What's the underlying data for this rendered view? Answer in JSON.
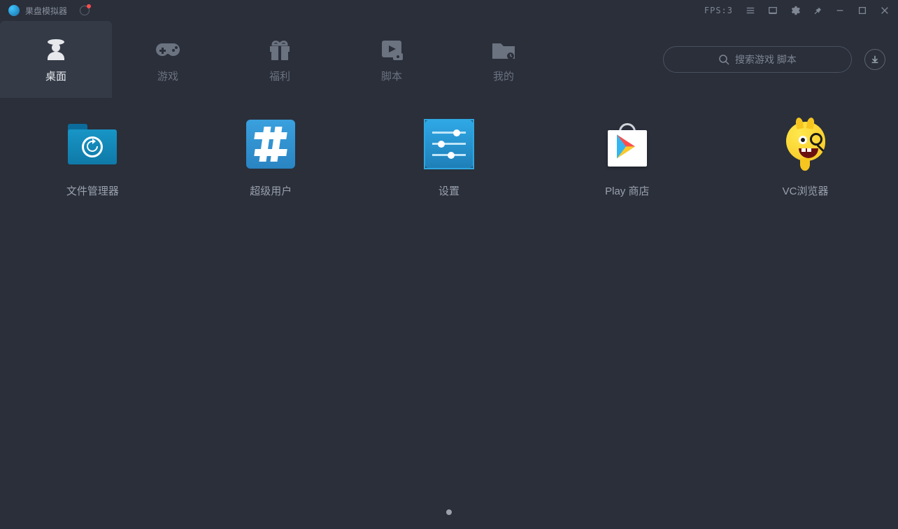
{
  "titlebar": {
    "app_name": "果盘模拟器",
    "fps_label": "FPS:3"
  },
  "tabs": [
    {
      "label": "桌面",
      "icon": "desktop-user-icon",
      "active": true
    },
    {
      "label": "游戏",
      "icon": "gamepad-icon",
      "active": false
    },
    {
      "label": "福利",
      "icon": "gift-icon",
      "active": false
    },
    {
      "label": "脚本",
      "icon": "script-icon",
      "active": false
    },
    {
      "label": "我的",
      "icon": "my-folder-icon",
      "active": false
    }
  ],
  "search": {
    "placeholder": "搜索游戏 脚本"
  },
  "apps": [
    {
      "label": "文件管理器",
      "icon": "file-manager-icon",
      "selected": false
    },
    {
      "label": "超级用户",
      "icon": "superuser-icon",
      "selected": false
    },
    {
      "label": "设置",
      "icon": "settings-icon",
      "selected": true
    },
    {
      "label": "Play 商店",
      "icon": "play-store-icon",
      "selected": false
    },
    {
      "label": "VC浏览器",
      "icon": "vc-browser-icon",
      "selected": false
    }
  ],
  "colors": {
    "bg": "#2a2f3a",
    "panel": "#343a46",
    "text_muted": "#6b7280",
    "text": "#e6e8ec",
    "accent_blue": "#2ea7e0"
  }
}
